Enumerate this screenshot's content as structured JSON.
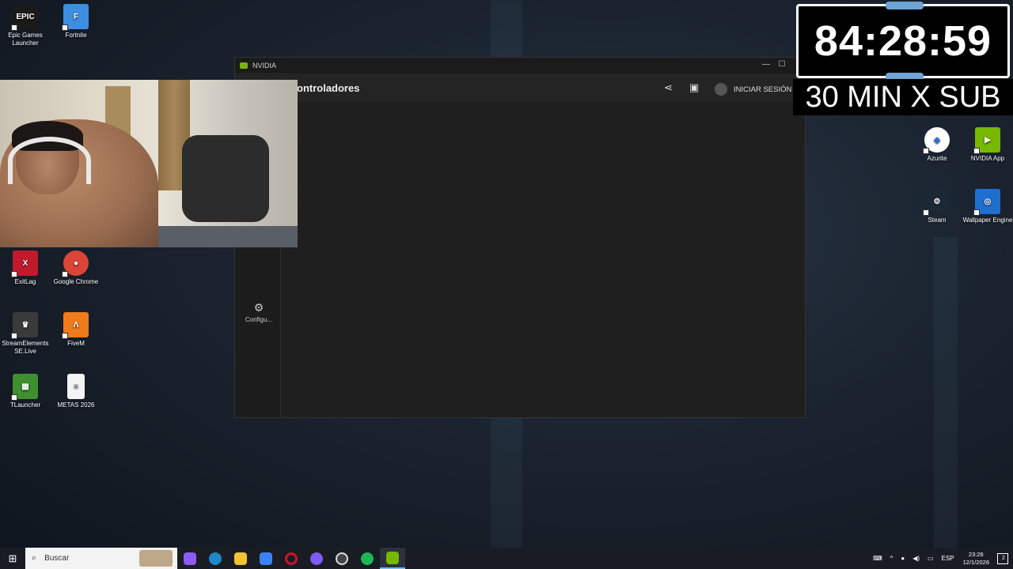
{
  "desktop": {
    "left_icons": [
      {
        "label": "Epic Games Launcher",
        "color": "#1a1a1a",
        "glyph": "EPIC"
      },
      {
        "label": "Fortnite",
        "color": "#3d8ee0",
        "glyph": "F"
      },
      {
        "label": "ExitLag",
        "color": "#c01a2c",
        "glyph": "X"
      },
      {
        "label": "Google Chrome",
        "color": "#db4437",
        "glyph": "●"
      },
      {
        "label": "StreamElements SE.Live",
        "color": "#3a3a3a",
        "glyph": "♛"
      },
      {
        "label": "FiveM",
        "color": "#f07b1d",
        "glyph": "Λ"
      },
      {
        "label": "TLauncher",
        "color": "#3f8f2f",
        "glyph": "▦"
      },
      {
        "label": "METAS 2026",
        "color": "#f4f4f4",
        "glyph": "≡"
      }
    ],
    "right_icons": [
      {
        "label": "Azurite",
        "color": "#ffffff",
        "glyph": "◆"
      },
      {
        "label": "NVIDIA App",
        "color": "#76b900",
        "glyph": "▶"
      },
      {
        "label": "Steam",
        "color": "#1b2838",
        "glyph": "⚙"
      },
      {
        "label": "Wallpaper Engine",
        "color": "#1f6fd1",
        "glyph": "◎"
      }
    ]
  },
  "nvidia": {
    "window_title": "NVIDIA",
    "minimize": "—",
    "maximize": "☐",
    "header_title": "ontroladores",
    "login_label": "INICIAR SESIÓN",
    "settings_label": "Configu..."
  },
  "overlay": {
    "timer": "84:28:59",
    "promo": "30 MIN X SUB"
  },
  "taskbar": {
    "search_placeholder": "Buscar",
    "apps": [
      {
        "name": "copilot",
        "color": "#8a5cf6"
      },
      {
        "name": "edge",
        "color": "#1e88c9"
      },
      {
        "name": "explorer",
        "color": "#f1c232"
      },
      {
        "name": "mail",
        "color": "#3b82f6"
      },
      {
        "name": "opera",
        "color": "#d0112b"
      },
      {
        "name": "discord",
        "color": "#7d5cf0"
      },
      {
        "name": "obs",
        "color": "#444444"
      },
      {
        "name": "spotify",
        "color": "#1db954"
      },
      {
        "name": "nvidia",
        "color": "#76b900"
      }
    ],
    "language": "ESP",
    "time": "23:26",
    "date": "12/1/2026",
    "notifications": "2"
  }
}
